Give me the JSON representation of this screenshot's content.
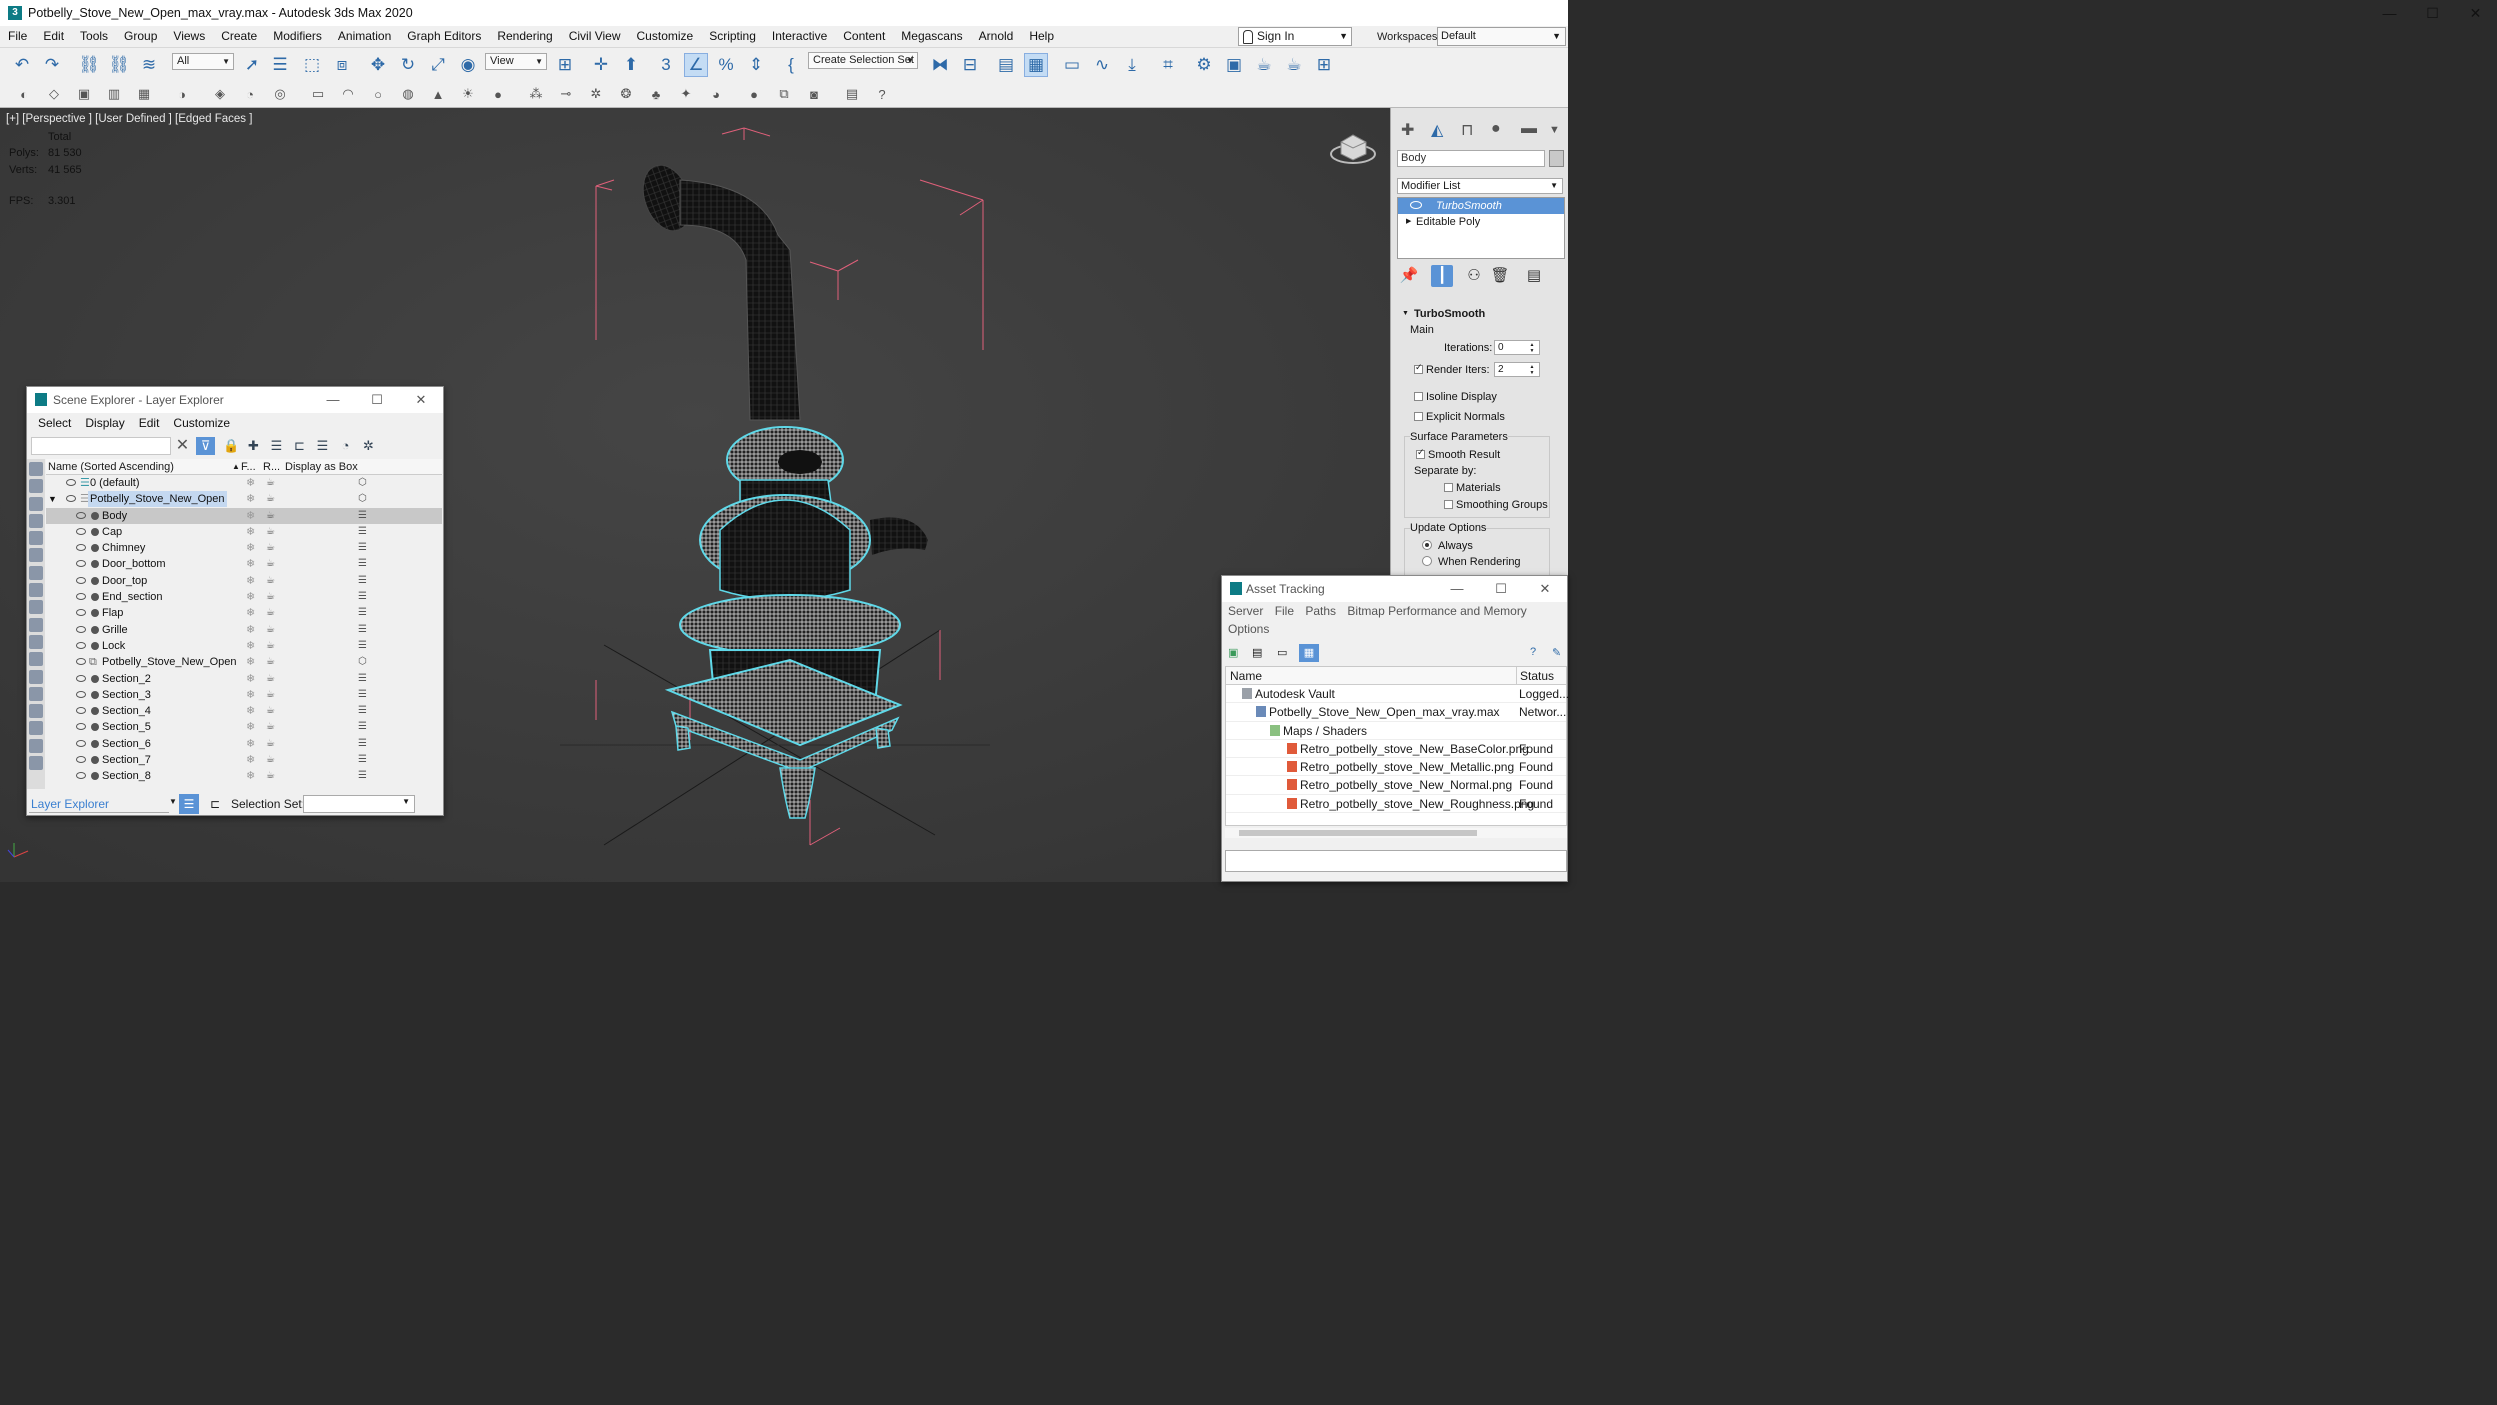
{
  "window": {
    "title": "Potbelly_Stove_New_Open_max_vray.max - Autodesk 3ds Max 2020",
    "logo": "3"
  },
  "menu": [
    "File",
    "Edit",
    "Tools",
    "Group",
    "Views",
    "Create",
    "Modifiers",
    "Animation",
    "Graph Editors",
    "Rendering",
    "Civil View",
    "Customize",
    "Scripting",
    "Interactive",
    "Content",
    "Megascans",
    "Arnold",
    "Help"
  ],
  "account": {
    "sign_in": "Sign In",
    "workspaces_label": "Workspaces:",
    "workspace": "Default"
  },
  "toolbar": {
    "filter": "All",
    "ref_coord": "View",
    "selection_set": "Create Selection Set"
  },
  "viewport": {
    "label": "[+] [Perspective ] [User Defined ] [Edged Faces ]",
    "stats_header": "Total",
    "polys_label": "Polys:",
    "polys": "81 530",
    "verts_label": "Verts:",
    "verts": "41 565",
    "fps_label": "FPS:",
    "fps": "3.301"
  },
  "command_panel": {
    "object_name": "Body",
    "modifier_list": "Modifier List",
    "stack": [
      "TurboSmooth",
      "Editable Poly"
    ],
    "rollout": "TurboSmooth",
    "main": "Main",
    "iterations_label": "Iterations:",
    "iterations": "0",
    "render_iters_label": "Render Iters:",
    "render_iters": "2",
    "isoline": "Isoline Display",
    "explicit_normals": "Explicit Normals",
    "surface_params": "Surface Parameters",
    "smooth_result": "Smooth Result",
    "separate_by": "Separate by:",
    "materials": "Materials",
    "smoothing_groups": "Smoothing Groups",
    "update_options": "Update Options",
    "always": "Always",
    "when_rendering": "When Rendering"
  },
  "scene_explorer": {
    "title": "Scene Explorer - Layer Explorer",
    "menu": [
      "Select",
      "Display",
      "Edit",
      "Customize"
    ],
    "columns": {
      "name": "Name (Sorted Ascending)",
      "frozen": "F...",
      "render": "R...",
      "display_box": "Display as Box"
    },
    "layers": [
      {
        "name": "0 (default)",
        "level": 0
      },
      {
        "name": "Potbelly_Stove_New_Open",
        "level": 0
      }
    ],
    "objects": [
      "Body",
      "Cap",
      "Chimney",
      "Door_bottom",
      "Door_top",
      "End_section",
      "Flap",
      "Grille",
      "Lock",
      "Potbelly_Stove_New_Open",
      "Section_2",
      "Section_3",
      "Section_4",
      "Section_5",
      "Section_6",
      "Section_7",
      "Section_8"
    ],
    "footer_mode": "Layer Explorer",
    "selection_set_label": "Selection Set:"
  },
  "asset_tracking": {
    "title": "Asset Tracking",
    "menu": [
      "Server",
      "File",
      "Paths",
      "Bitmap Performance and Memory",
      "Options"
    ],
    "columns": {
      "name": "Name",
      "status": "Status"
    },
    "rows": [
      {
        "name": "Autodesk Vault",
        "status": "Logged..."
      },
      {
        "name": "Potbelly_Stove_New_Open_max_vray.max",
        "status": "Networ..."
      },
      {
        "name": "Maps / Shaders",
        "status": ""
      },
      {
        "name": "Retro_potbelly_stove_New_BaseColor.png",
        "status": "Found"
      },
      {
        "name": "Retro_potbelly_stove_New_Metallic.png",
        "status": "Found"
      },
      {
        "name": "Retro_potbelly_stove_New_Normal.png",
        "status": "Found"
      },
      {
        "name": "Retro_potbelly_stove_New_Roughness.png",
        "status": "Found"
      }
    ]
  },
  "colors": {
    "selection_outline": "#5fd8e8",
    "bounding_box": "#e0607a",
    "stats_text": "#ffdc6c",
    "active_blue": "#5a93d6"
  }
}
